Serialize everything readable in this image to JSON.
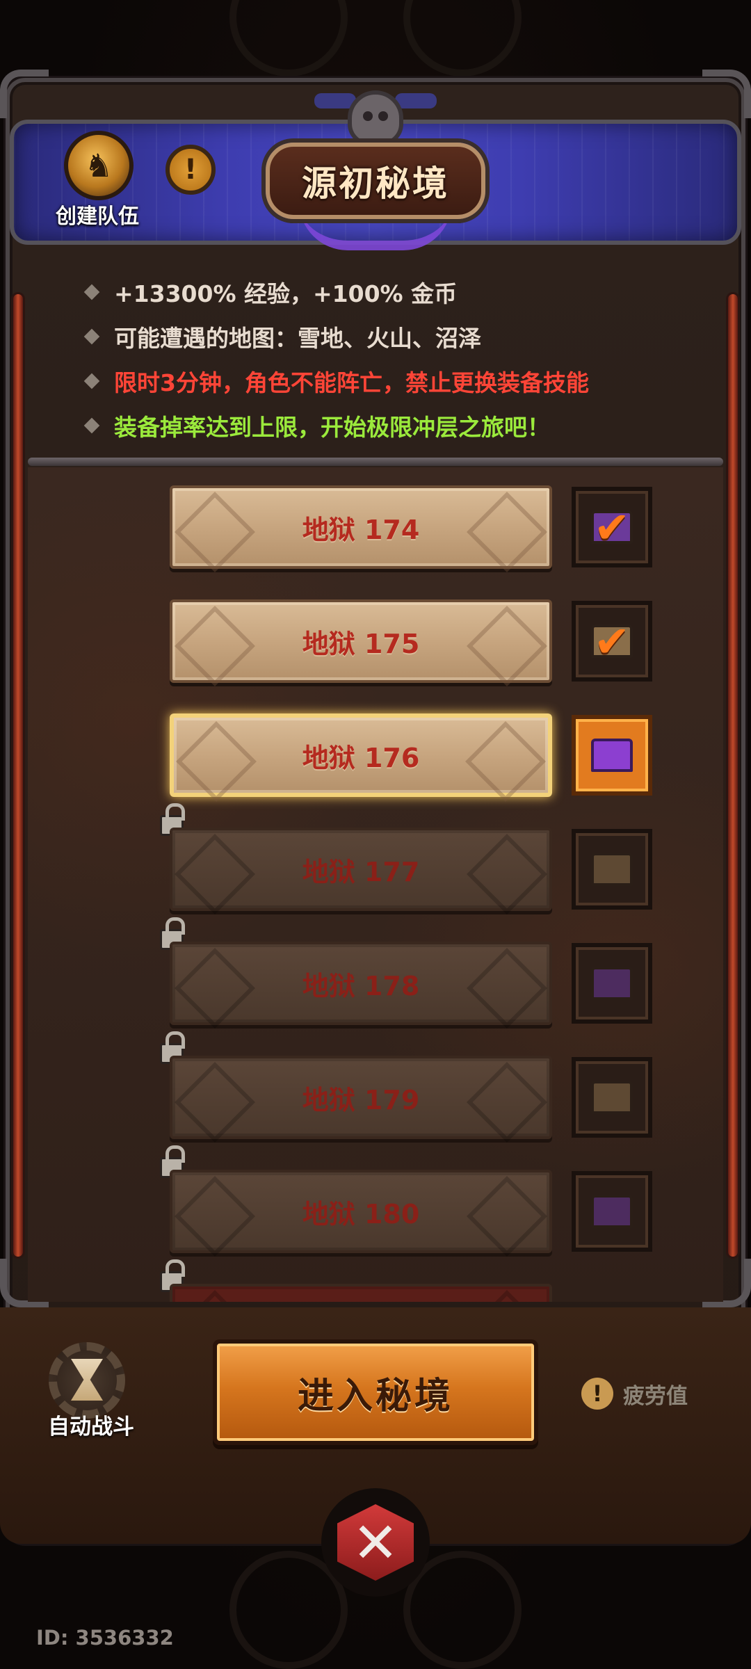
{
  "header": {
    "title": "源初秘境",
    "team_label": "创建队伍",
    "info_glyph": "!"
  },
  "description": {
    "lines": [
      {
        "text": "+13300% 经验，+100% 金币",
        "color": "#e8dcd0"
      },
      {
        "text": "可能遭遇的地图：雪地、火山、沼泽",
        "color": "#e8dcd0"
      },
      {
        "text": "限时3分钟，角色不能阵亡，禁止更换装备技能",
        "color": "#ff4537"
      },
      {
        "text": "装备掉率达到上限，开始极限冲层之旅吧！",
        "color": "#9bea3c"
      }
    ]
  },
  "levels": [
    {
      "label": "地狱 174",
      "state": "completed",
      "chest": "purple",
      "check": "✔"
    },
    {
      "label": "地狱 175",
      "state": "completed",
      "chest": "gold",
      "check": "✔"
    },
    {
      "label": "地狱 176",
      "state": "selected",
      "chest": "purple",
      "check": ""
    },
    {
      "label": "地狱 177",
      "state": "locked",
      "chest": "gold",
      "check": ""
    },
    {
      "label": "地狱 178",
      "state": "locked",
      "chest": "purple",
      "check": ""
    },
    {
      "label": "地狱 179",
      "state": "locked",
      "chest": "gold",
      "check": ""
    },
    {
      "label": "地狱 180",
      "state": "locked",
      "chest": "purple",
      "check": ""
    }
  ],
  "footer": {
    "auto_battle_label": "自动战斗",
    "enter_label": "进入秘境",
    "fatigue_label": "疲劳值",
    "fatigue_glyph": "!",
    "close_glyph": "✕",
    "player_id": "ID: 3536332"
  },
  "colors": {
    "accent_orange": "#d6761e",
    "level_text_red": "#b52a1f",
    "selected_border": "#f3d27a",
    "banner_blue": "#3e3db0"
  }
}
